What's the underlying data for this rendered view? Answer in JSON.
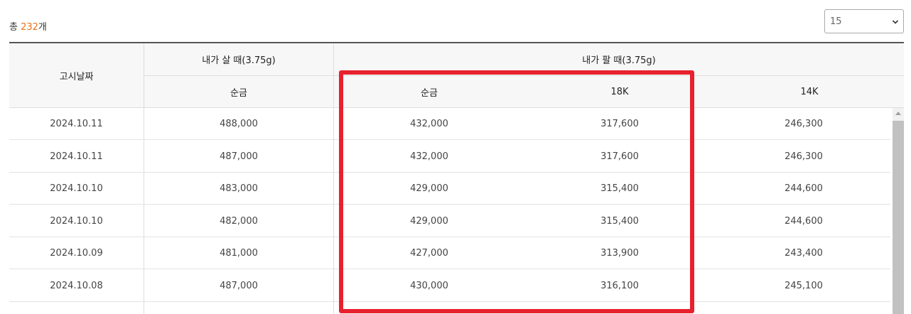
{
  "summary": {
    "prefix": "총 ",
    "count": "232",
    "suffix": "개"
  },
  "page_size": {
    "selected": "15"
  },
  "table": {
    "header": {
      "date": "고시날짜",
      "buy_group": "내가 살 때(3.75g)",
      "sell_group": "내가 팔 때(3.75g)",
      "buy_pure": "순금",
      "sell_pure": "순금",
      "sell_18k": "18K",
      "sell_14k": "14K"
    },
    "rows": [
      {
        "date": "2024.10.11",
        "buy_pure": "488,000",
        "sell_pure": "432,000",
        "sell_18k": "317,600",
        "sell_14k": "246,300"
      },
      {
        "date": "2024.10.11",
        "buy_pure": "487,000",
        "sell_pure": "432,000",
        "sell_18k": "317,600",
        "sell_14k": "246,300"
      },
      {
        "date": "2024.10.10",
        "buy_pure": "483,000",
        "sell_pure": "429,000",
        "sell_18k": "315,400",
        "sell_14k": "244,600"
      },
      {
        "date": "2024.10.10",
        "buy_pure": "482,000",
        "sell_pure": "429,000",
        "sell_18k": "315,400",
        "sell_14k": "244,600"
      },
      {
        "date": "2024.10.09",
        "buy_pure": "481,000",
        "sell_pure": "427,000",
        "sell_18k": "313,900",
        "sell_14k": "243,400"
      },
      {
        "date": "2024.10.08",
        "buy_pure": "487,000",
        "sell_pure": "430,000",
        "sell_18k": "316,100",
        "sell_14k": "245,100"
      }
    ]
  },
  "colors": {
    "highlight": "#e8212e",
    "count_accent": "#e8721c"
  },
  "icons": {
    "select_arrow": "chevron-down-icon",
    "scroll_up": "scroll-up-arrow-icon"
  }
}
